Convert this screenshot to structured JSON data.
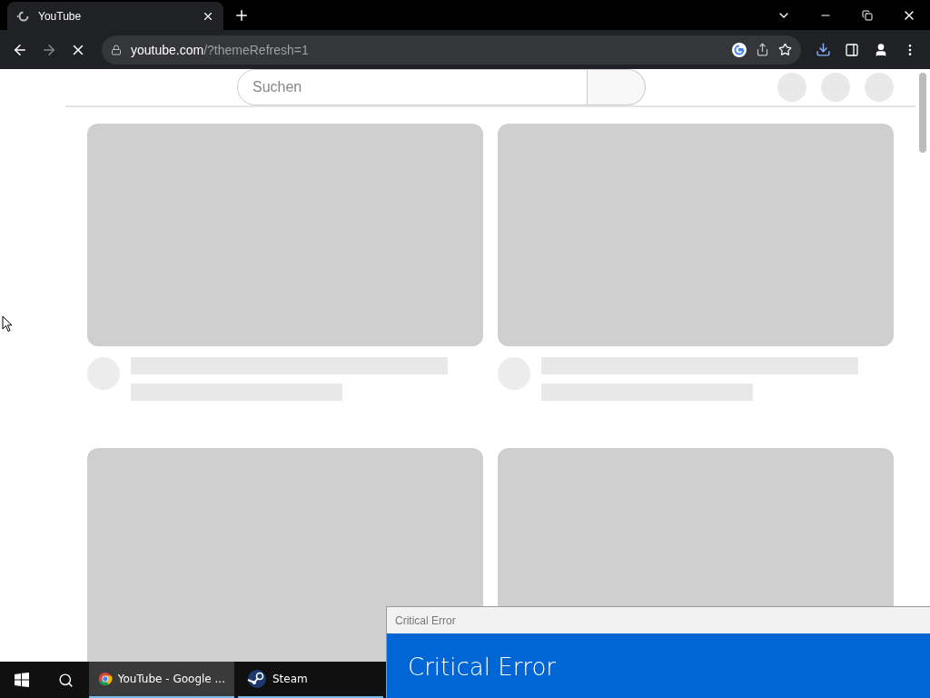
{
  "browser": {
    "tab": {
      "title": "YouTube",
      "selected": true
    },
    "loading": true,
    "url": {
      "host": "youtube.com",
      "path": "/?themeRefresh=1"
    }
  },
  "page": {
    "search": {
      "placeholder": "Suchen"
    },
    "cards": [
      {
        "kind": "video"
      },
      {
        "kind": "video"
      },
      {
        "kind": "thumbnail"
      },
      {
        "kind": "thumbnail"
      }
    ]
  },
  "taskbar": {
    "items": [
      {
        "label": "YouTube - Google ...",
        "selected": true
      },
      {
        "label": "Steam",
        "selected": false
      }
    ]
  },
  "dialog": {
    "title": "Critical Error",
    "heading": "Critical Error"
  }
}
